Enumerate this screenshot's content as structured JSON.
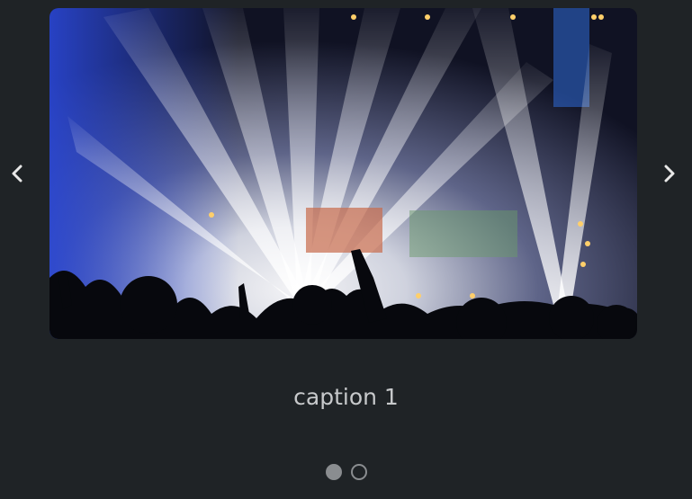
{
  "slides": [
    {
      "caption": "caption 1",
      "image_icon": "concert-photo-image"
    }
  ],
  "current_slide": 1,
  "slide_count": 2,
  "nav": {
    "prev_icon": "chevron-left-icon",
    "next_icon": "chevron-right-icon"
  },
  "colors": {
    "background": "#1f2326",
    "caption_text": "#c7c9cb",
    "arrow": "#e8e8e8",
    "dot": "#8a8d90"
  }
}
